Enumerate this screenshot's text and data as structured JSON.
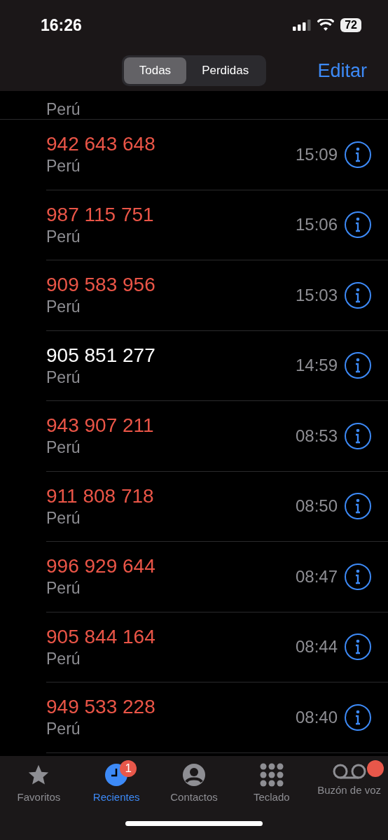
{
  "status_bar": {
    "time": "16:26",
    "battery": "72"
  },
  "segments": [
    {
      "label": "Todas",
      "selected": true
    },
    {
      "label": "Perdidas",
      "selected": false
    }
  ],
  "edit_button": "Editar",
  "partial_row": {
    "country": "Perú"
  },
  "calls": [
    {
      "number": "942 643 648",
      "country": "Perú",
      "time": "15:09",
      "missed": true
    },
    {
      "number": "987 115 751",
      "country": "Perú",
      "time": "15:06",
      "missed": true
    },
    {
      "number": "909 583 956",
      "country": "Perú",
      "time": "15:03",
      "missed": true
    },
    {
      "number": "905 851 277",
      "country": "Perú",
      "time": "14:59",
      "missed": false
    },
    {
      "number": "943 907 211",
      "country": "Perú",
      "time": "08:53",
      "missed": true
    },
    {
      "number": "911 808 718",
      "country": "Perú",
      "time": "08:50",
      "missed": true
    },
    {
      "number": "996 929 644",
      "country": "Perú",
      "time": "08:47",
      "missed": true
    },
    {
      "number": "905 844 164",
      "country": "Perú",
      "time": "08:44",
      "missed": true
    },
    {
      "number": "949 533 228",
      "country": "Perú",
      "time": "08:40",
      "missed": true
    }
  ],
  "tab_bar": [
    {
      "kind": "star",
      "label": "Favoritos",
      "selected": false
    },
    {
      "kind": "clock",
      "label": "Recientes",
      "selected": true,
      "badge": "1"
    },
    {
      "kind": "person",
      "label": "Contactos",
      "selected": false
    },
    {
      "kind": "keypad",
      "label": "Teclado",
      "selected": false
    },
    {
      "kind": "voicemail",
      "label": "Buzón de voz",
      "selected": false,
      "dot": true
    }
  ]
}
